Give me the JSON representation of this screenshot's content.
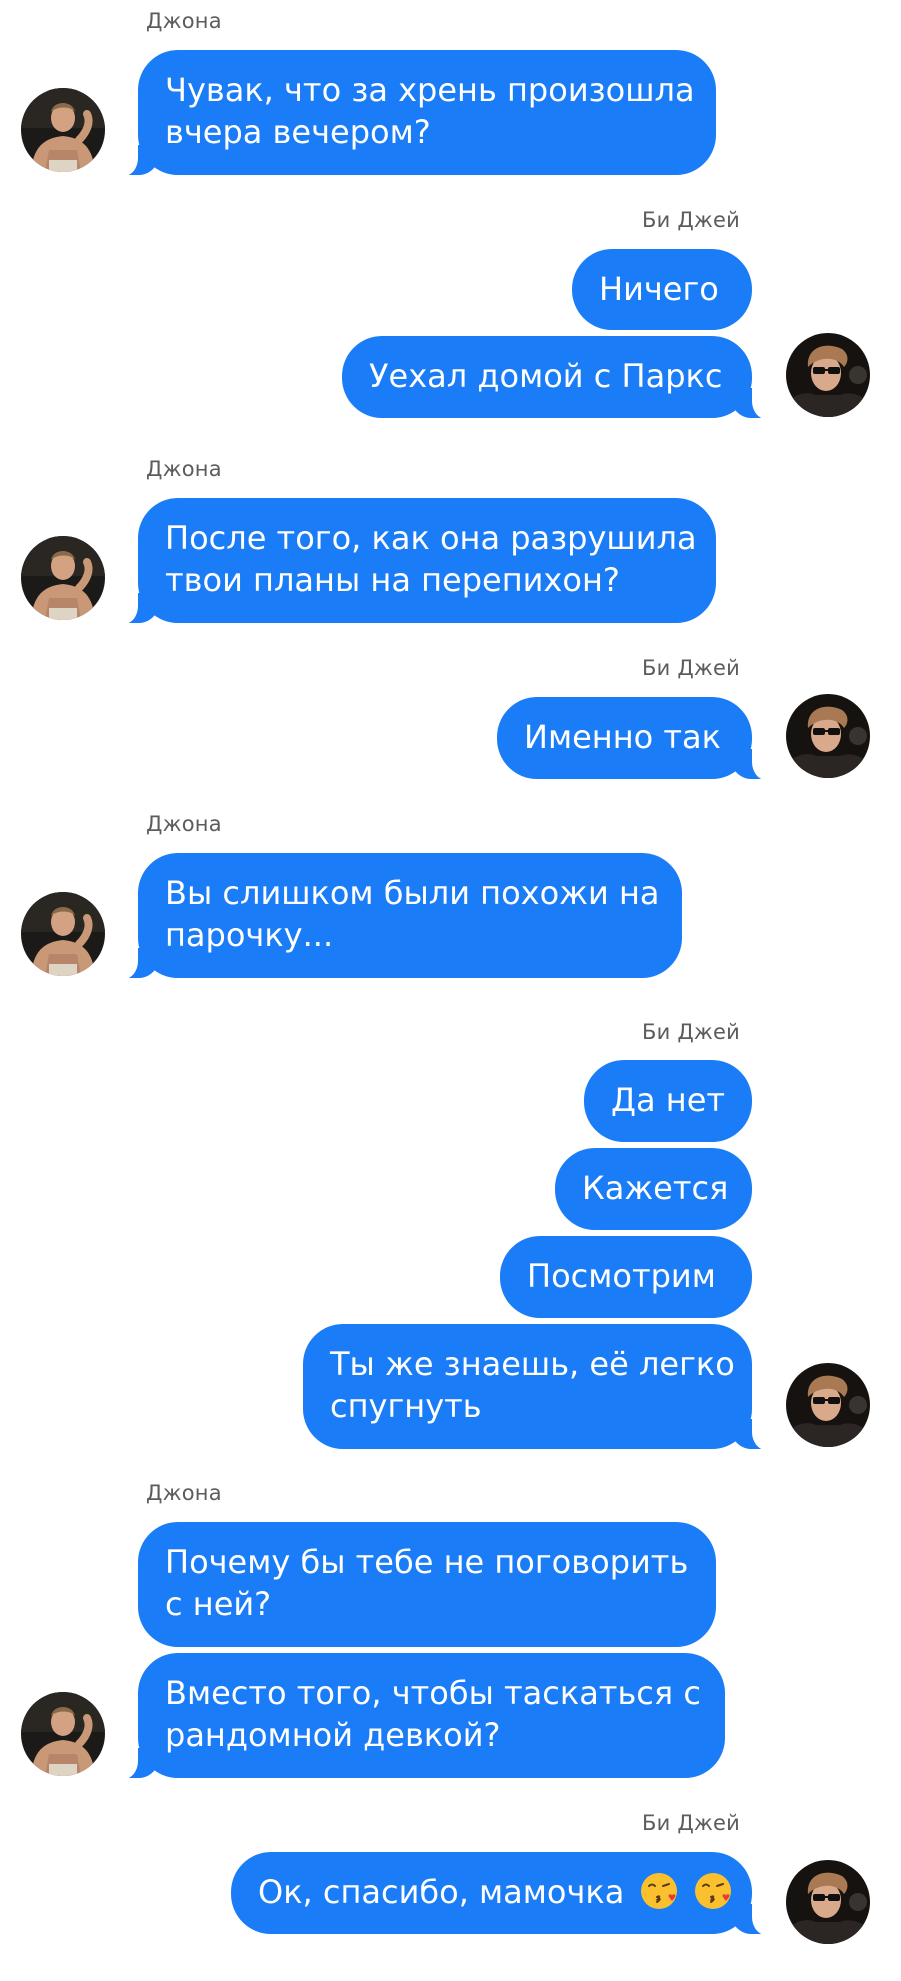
{
  "contacts": {
    "left": {
      "name": "Джона",
      "avatar_icon": "shirtless-man-avatar-icon"
    },
    "right": {
      "name": "Би Джей",
      "avatar_icon": "man-sunglasses-avatar-icon"
    }
  },
  "colors": {
    "bubble": "#1a7cf6",
    "bubble_text": "#ffffff",
    "sender_name": "#5c5c5c",
    "background": "#ffffff"
  },
  "messages": [
    {
      "sender": "Джона",
      "lines": [
        "Чувак, что за хрень произошла",
        "вчера вечером?"
      ]
    },
    {
      "sender": "Би Джей",
      "lines": [
        "Ничего"
      ]
    },
    {
      "sender": "Би Джей",
      "lines": [
        "Уехал домой с Паркс"
      ]
    },
    {
      "sender": "Джона",
      "lines": [
        "После того, как она разрушила",
        "твои планы на перепихон?"
      ]
    },
    {
      "sender": "Би Джей",
      "lines": [
        "Именно так"
      ]
    },
    {
      "sender": "Джона",
      "lines": [
        "Вы слишком были похожи на",
        "парочку..."
      ]
    },
    {
      "sender": "Би Джей",
      "lines": [
        "Да нет"
      ]
    },
    {
      "sender": "Би Джей",
      "lines": [
        "Кажется"
      ]
    },
    {
      "sender": "Би Джей",
      "lines": [
        "Посмотрим"
      ]
    },
    {
      "sender": "Би Джей",
      "lines": [
        "Ты же знаешь, её легко",
        "спугнуть"
      ]
    },
    {
      "sender": "Джона",
      "lines": [
        "Почему бы тебе не поговорить",
        "с ней?"
      ]
    },
    {
      "sender": "Джона",
      "lines": [
        "Вместо того, чтобы таскаться с",
        "рандомной девкой?"
      ]
    },
    {
      "sender": "Би Джей",
      "lines": [
        "Ок, спасибо, мамочка"
      ],
      "emoji_icons": [
        "kissing-face-icon",
        "kissing-face-icon"
      ]
    }
  ]
}
